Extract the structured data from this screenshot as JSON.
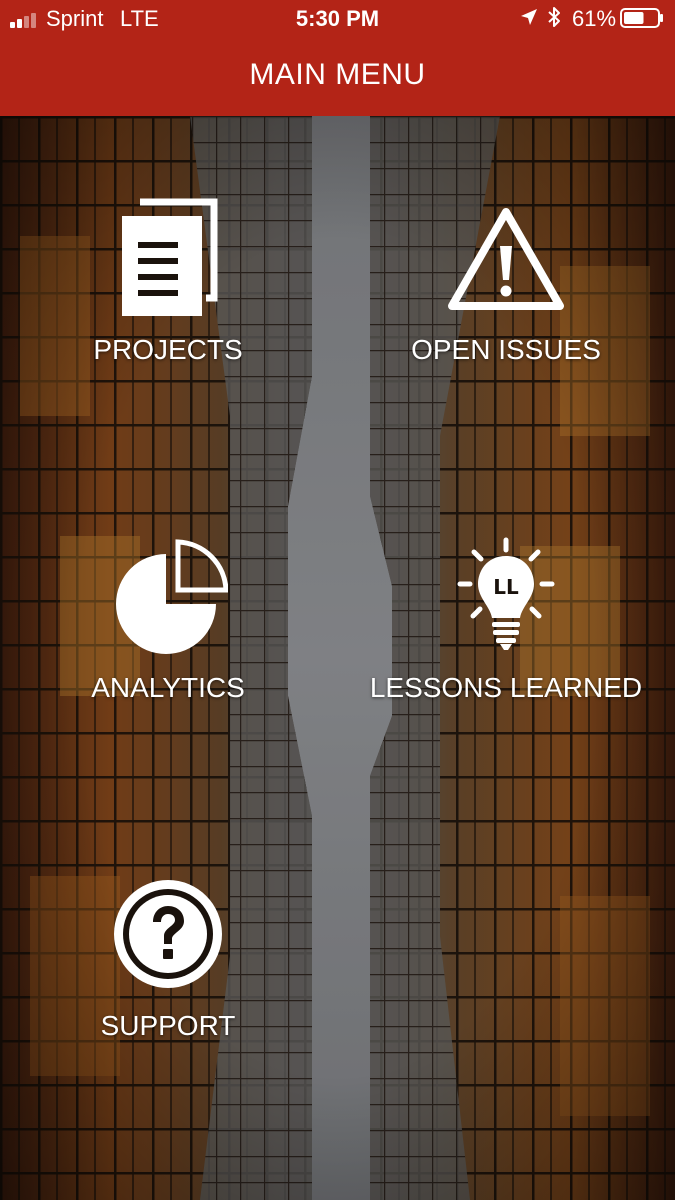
{
  "status_bar": {
    "carrier": "Sprint",
    "network": "LTE",
    "time": "5:30 PM",
    "battery_percent": "61%",
    "battery_level": 0.61,
    "signal_bars_filled": 2,
    "signal_bars_total": 4,
    "icons": [
      "signal-icon",
      "location-arrow-icon",
      "bluetooth-icon",
      "battery-icon"
    ]
  },
  "header": {
    "title": "MAIN MENU",
    "background_color": "#b32417"
  },
  "menu": {
    "items": [
      {
        "label": "PROJECTS",
        "icon": "documents-icon"
      },
      {
        "label": "OPEN ISSUES",
        "icon": "warning-icon"
      },
      {
        "label": "ANALYTICS",
        "icon": "pie-chart-icon"
      },
      {
        "label": "LESSONS LEARNED",
        "icon": "lightbulb-icon"
      },
      {
        "label": "SUPPORT",
        "icon": "help-circle-icon"
      }
    ]
  },
  "colors": {
    "header": "#b32417",
    "text": "#ffffff"
  }
}
